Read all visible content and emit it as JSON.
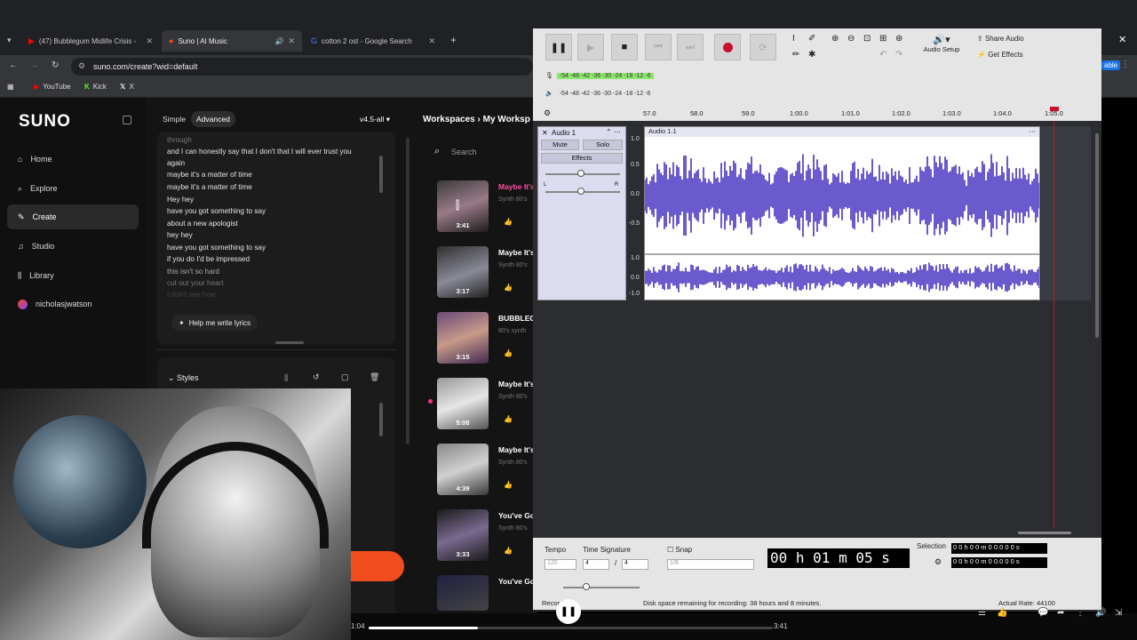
{
  "browser": {
    "tabs": [
      {
        "title": "(47) Bubblegum Midlife Crisis -",
        "active": false
      },
      {
        "title": "Suno | AI Music",
        "active": true
      },
      {
        "title": "cotton 2 ost - Google Search",
        "active": false
      }
    ],
    "url": "suno.com/create?wid=default",
    "bookmarks": [
      "YouTube",
      "Kick",
      "X"
    ],
    "right_fragment": "able"
  },
  "suno": {
    "logo": "SUNO",
    "nav": [
      {
        "label": "Home",
        "icon": "home-icon"
      },
      {
        "label": "Explore",
        "icon": "search-icon"
      },
      {
        "label": "Create",
        "icon": "sparkle-icon"
      },
      {
        "label": "Studio",
        "icon": "studio-icon"
      },
      {
        "label": "Library",
        "icon": "library-icon"
      },
      {
        "label": "nicholasjwatson",
        "icon": "avatar"
      }
    ],
    "mode_tabs": [
      "Simple",
      "Advanced"
    ],
    "version": "v4.5-all",
    "lyrics": [
      "and I can honestly say that I don't that I will ever trust you",
      "again",
      "maybe it's a matter of time",
      "maybe it's a matter of time",
      "Hey hey",
      "have you got something to say",
      "about a new apologist",
      "hey hey",
      "have you got something to say",
      "if you do I'd be impressed",
      "this isn't so hard",
      "cut out your heart",
      "I don't see how"
    ],
    "lyrics_partial_top": "through",
    "help_button": "Help me write lyrics",
    "styles_label": "Styles",
    "workspace_breadcrumb": [
      "Workspaces",
      "My Worksp"
    ],
    "search_placeholder": "Search",
    "songs": [
      {
        "title": "Maybe It's",
        "sub": "Synth 80's",
        "duration": "3:41",
        "highlight": true
      },
      {
        "title": "Maybe It's",
        "sub": "Synth 80's",
        "duration": "3:17",
        "highlight": false
      },
      {
        "title": "BUBBLEG",
        "sub": "80's synth",
        "duration": "3:15",
        "highlight": false
      },
      {
        "title": "Maybe It's",
        "sub": "Synth 80's",
        "duration": "5:08",
        "highlight": false
      },
      {
        "title": "Maybe It's",
        "sub": "Synth 80's",
        "duration": "4:39",
        "highlight": false
      },
      {
        "title": "You've Go",
        "sub": "Synth 80's",
        "duration": "3:33",
        "highlight": false
      },
      {
        "title": "You've Go",
        "sub": "",
        "duration": "",
        "highlight": false
      }
    ],
    "player": {
      "elapsed": "1:04",
      "total": "3:41",
      "progress": 0.27
    }
  },
  "audacity": {
    "meter_rec_ticks": "-54 -48 -42 -36 -30 -24 -18 -12 -6",
    "meter_play_ticks": "-54 -48 -42 -36 -30 -24 -18 -12 -6",
    "audio_setup": "Audio Setup",
    "share_audio": "Share Audio",
    "get_effects": "Get Effects",
    "ruler": [
      "57.0",
      "58.0",
      "59.0",
      "1:00.0",
      "1:01.0",
      "1:02.0",
      "1:03.0",
      "1:04.0",
      "1:05.0"
    ],
    "track_name": "Audio 1",
    "clip_name": "Audio 1.1",
    "mute": "Mute",
    "solo": "Solo",
    "effects": "Effects",
    "pan_left": "L",
    "pan_right": "R",
    "scale_top": [
      "1.0",
      "0.5",
      "0.0",
      "-0.5"
    ],
    "scale_bottom": [
      "1.0",
      "0.0",
      "-1.0"
    ],
    "tempo_label": "Tempo",
    "tempo_value": "120",
    "time_sig_label": "Time Signature",
    "time_sig_num": "4",
    "time_sig_den": "4",
    "snap_label": "Snap",
    "snap_value": "1/8",
    "time_display": "00 h 01 m 05 s",
    "selection_label": "Selection",
    "selection_start": "0 0 h 0 0 m 0 0.0 0 0 s",
    "selection_end": "0 0 h 0 0 m 0 0.0 0 0 s",
    "status_left": "Recording.",
    "status_middle": "Disk space remaining for recording: 38 hours and 8 minutes.",
    "status_right": "Actual Rate: 44100"
  },
  "colors": {
    "accent_orange": "#f24d1f",
    "waveform": "#6a5acd",
    "record_red": "#c8102e",
    "meter_green": "#8ee86d"
  }
}
